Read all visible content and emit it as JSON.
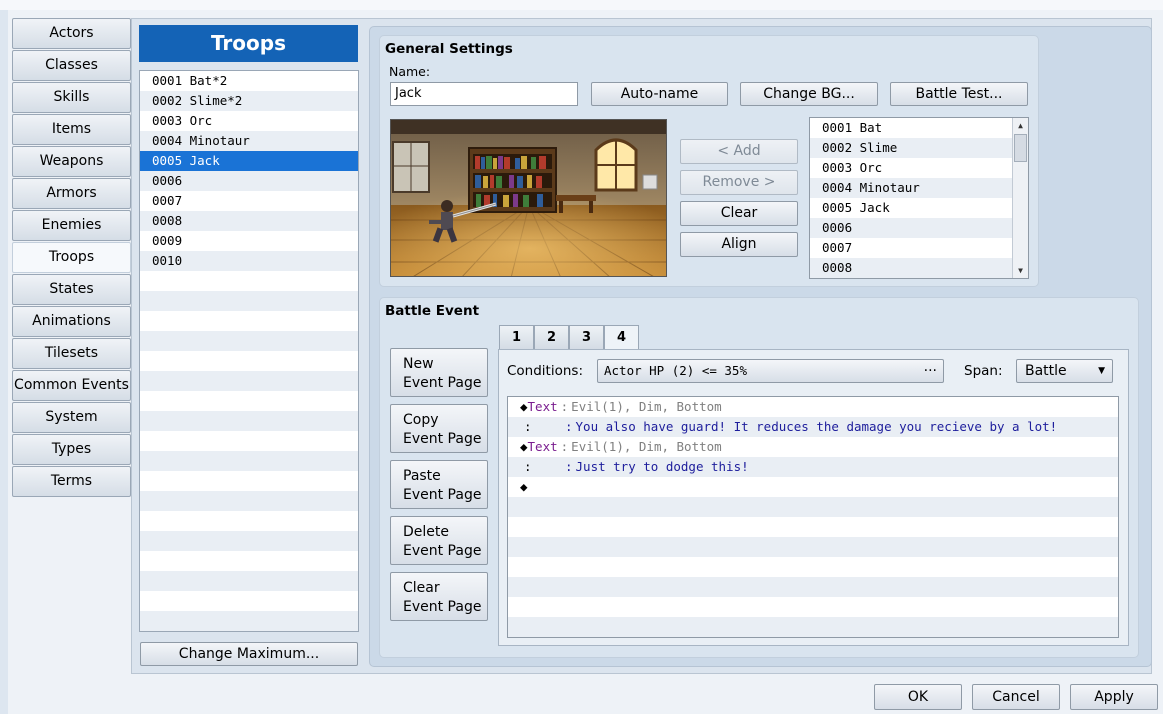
{
  "categories": [
    "Actors",
    "Classes",
    "Skills",
    "Items",
    "Weapons",
    "Armors",
    "Enemies",
    "Troops",
    "States",
    "Animations",
    "Tilesets",
    "Common Events",
    "System",
    "Types",
    "Terms"
  ],
  "active_category": "Troops",
  "troops": {
    "header": "Troops",
    "items": [
      "0001 Bat*2",
      "0002 Slime*2",
      "0003 Orc",
      "0004 Minotaur",
      "0005 Jack",
      "0006",
      "0007",
      "0008",
      "0009",
      "0010"
    ],
    "selected_index": 4,
    "change_max_label": "Change Maximum..."
  },
  "general": {
    "title": "General Settings",
    "name_label": "Name:",
    "name_value": "Jack",
    "autoname_label": "Auto-name",
    "changebg_label": "Change BG...",
    "battletest_label": "Battle Test...",
    "add_label": "< Add",
    "remove_label": "Remove >",
    "clear_label": "Clear",
    "align_label": "Align",
    "enemies": [
      "0001 Bat",
      "0002 Slime",
      "0003 Orc",
      "0004 Minotaur",
      "0005 Jack",
      "0006",
      "0007",
      "0008"
    ]
  },
  "battle_event": {
    "title": "Battle Event",
    "tabs": [
      "1",
      "2",
      "3",
      "4"
    ],
    "active_tab": "4",
    "page_buttons": [
      {
        "line1": "New",
        "line2": "Event Page"
      },
      {
        "line1": "Copy",
        "line2": "Event Page"
      },
      {
        "line1": "Paste",
        "line2": "Event Page"
      },
      {
        "line1": "Delete",
        "line2": "Event Page"
      },
      {
        "line1": "Clear",
        "line2": "Event Page"
      }
    ],
    "conditions_label": "Conditions:",
    "conditions_value": "Actor HP (2) <= 35%",
    "conditions_more": "···",
    "span_label": "Span:",
    "span_value": "Battle",
    "events": {
      "r1": {
        "marker": "◆",
        "cmd": "Text",
        "sep": ":",
        "params": "Evil(1), Dim, Bottom"
      },
      "r2": {
        "cont": ":",
        "sep": ":",
        "text": "You also have guard! It reduces the damage you recieve by a lot!"
      },
      "r3": {
        "marker": "◆",
        "cmd": "Text",
        "sep": ":",
        "params": "Evil(1), Dim, Bottom"
      },
      "r4": {
        "cont": ":",
        "sep": ":",
        "text": "Just try to dodge this!"
      },
      "r5": {
        "marker": "◆"
      }
    }
  },
  "footer": {
    "ok": "OK",
    "cancel": "Cancel",
    "apply": "Apply"
  }
}
